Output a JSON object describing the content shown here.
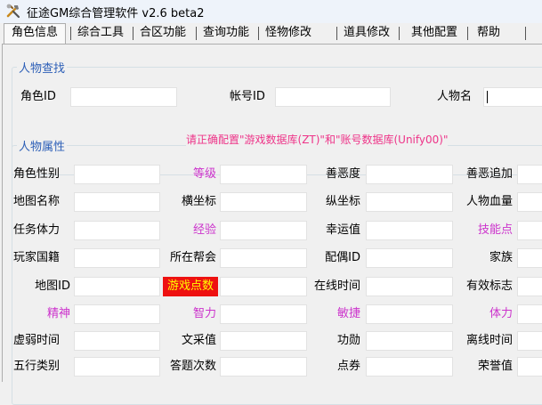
{
  "window": {
    "title": "征途GM综合管理软件 v2.6 beta2",
    "icon": "tools-icon"
  },
  "tabs": [
    {
      "label": "角色信息",
      "active": true
    },
    {
      "label": "综合工具"
    },
    {
      "label": "合区功能"
    },
    {
      "label": "查询功能"
    },
    {
      "label": "怪物修改"
    },
    {
      "label": "道具修改"
    },
    {
      "label": "其他配置"
    },
    {
      "label": "帮助"
    }
  ],
  "search": {
    "legend": "人物查找",
    "role_id_label": "角色ID",
    "role_id_value": "",
    "account_label": "帐号ID",
    "account_value": "",
    "name_label": "人物名",
    "name_value": ""
  },
  "attributes": {
    "legend": "人物属性",
    "hint": "请正确配置\"游戏数据库(ZT)\"和\"账号数据库(Unify00)\"",
    "rows": [
      [
        "角色性别",
        "等级",
        "善恶度",
        "善恶追加"
      ],
      [
        "地图名称",
        "横坐标",
        "纵坐标",
        "人物血量"
      ],
      [
        "任务体力",
        "经验",
        "幸运值",
        "技能点"
      ],
      [
        "玩家国籍",
        "所在帮会",
        "配偶ID",
        "家族"
      ],
      [
        "地图ID",
        "游戏点数",
        "在线时间",
        "有效标志"
      ],
      [
        "精神",
        "智力",
        "敏捷",
        "体力"
      ],
      [
        "虚弱时间",
        "文采值",
        "功勋",
        "离线时间"
      ],
      [
        "五行类别",
        "答题次数",
        "点券",
        "荣誉值"
      ]
    ]
  },
  "colors": {
    "accent": "#2d5fb7",
    "stat_pink": "#cc33cc",
    "hint_pink": "#ee3388",
    "points_bg": "#ee1111",
    "points_fg": "#ffff00"
  }
}
